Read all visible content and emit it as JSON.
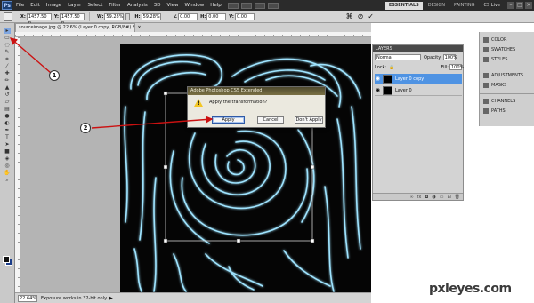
{
  "app": {
    "logo": "Ps",
    "menu": [
      "File",
      "Edit",
      "Image",
      "Layer",
      "Select",
      "Filter",
      "Analysis",
      "3D",
      "View",
      "Window",
      "Help"
    ],
    "workspaces": [
      "ESSENTIALS",
      "DESIGN",
      "PAINTING"
    ],
    "active_workspace": "ESSENTIALS",
    "cs_live": "CS Live"
  },
  "options": {
    "x_value": "1457.50 p",
    "y_value": "1457.50 p",
    "w_label": "W:",
    "w_value": "59.28%",
    "h_label": "H:",
    "h_value": "59.28%",
    "x_label": "X:",
    "y_label": "Y:",
    "angle_value": "0.00",
    "h_skew_label": "H:",
    "h_skew_value": "0.00",
    "v_skew_label": "V:",
    "v_skew_value": "0.00"
  },
  "document": {
    "tab_title": "sourceimage.jpg @ 22.6% (Layer 0 copy, RGB/8#) *",
    "zoom": "22.64%",
    "status": "Exposure works in 32-bit only"
  },
  "dialog": {
    "title": "Adobe Photoshop CS5 Extended",
    "message": "Apply the transformation?",
    "apply_label": "Apply",
    "cancel_label": "Cancel",
    "dont_apply_label": "Don't Apply"
  },
  "callouts": [
    "1",
    "2"
  ],
  "layers": {
    "title": "LAYERS",
    "blend_mode": "Normal",
    "opacity_label": "Opacity:",
    "opacity": "100%",
    "lock_label": "Lock:",
    "fill_label": "Fill:",
    "fill": "100%",
    "items": [
      {
        "name": "Layer 0 copy",
        "active": true
      },
      {
        "name": "Layer 0",
        "active": false
      }
    ]
  },
  "side_panels": [
    "COLOR",
    "SWATCHES",
    "STYLES",
    "ADJUSTMENTS",
    "MASKS",
    "CHANNELS",
    "PATHS"
  ],
  "watermark": "pxleyes.com",
  "colors": {
    "accent": "#4f93e3",
    "annotation_arrow": "#cc1111",
    "canvas": "#050505",
    "glow": "#9fe4ff"
  }
}
